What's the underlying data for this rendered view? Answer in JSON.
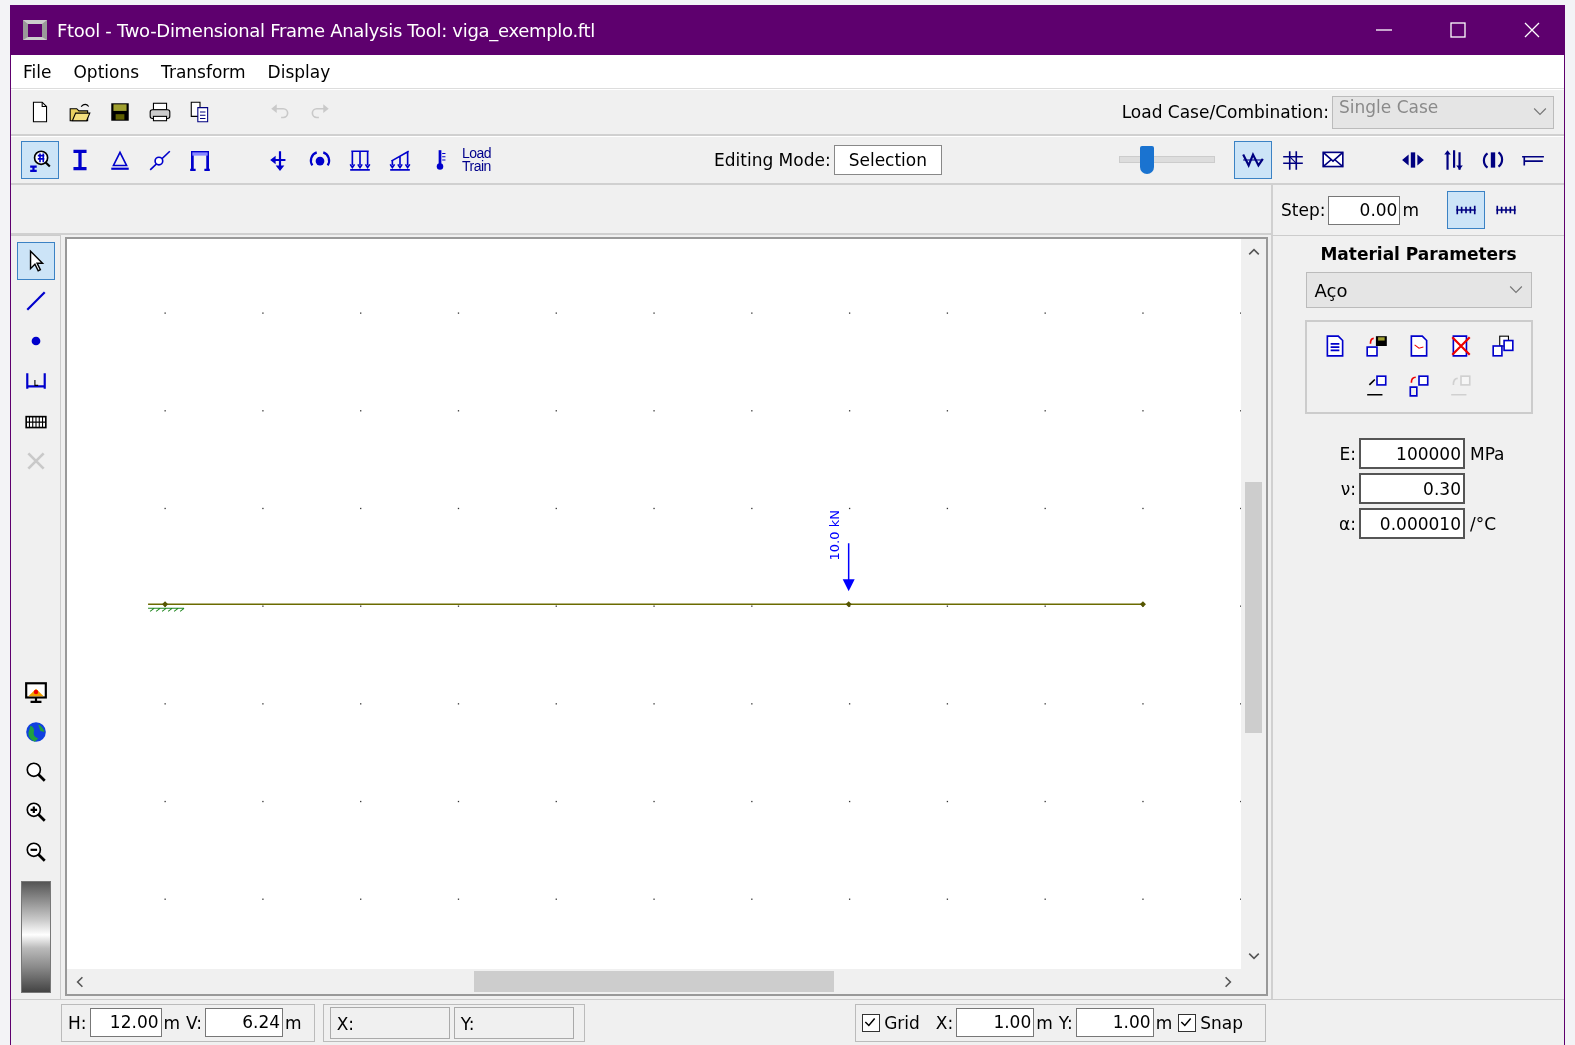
{
  "window": {
    "title": "Ftool - Two-Dimensional Frame Analysis Tool: viga_exemplo.ftl"
  },
  "menu": [
    "File",
    "Options",
    "Transform",
    "Display"
  ],
  "file_toolbar": [
    {
      "kind": "new",
      "disabled": false
    },
    {
      "kind": "open",
      "disabled": false
    },
    {
      "kind": "save",
      "disabled": false
    },
    {
      "kind": "print",
      "disabled": false
    },
    {
      "kind": "copy",
      "disabled": false
    },
    {
      "kind": "gap"
    },
    {
      "kind": "undo",
      "disabled": true
    },
    {
      "kind": "redo",
      "disabled": true
    }
  ],
  "load_case": {
    "label": "Load Case/Combination:",
    "value": "Single Case",
    "disabled": true
  },
  "model_toolbar": [
    {
      "kind": "section-query",
      "selected": true
    },
    {
      "kind": "section",
      "selected": false
    },
    {
      "kind": "support",
      "selected": false
    },
    {
      "kind": "hinge",
      "selected": false
    },
    {
      "kind": "frame",
      "selected": false
    },
    {
      "kind": "gap"
    },
    {
      "kind": "nodal-load",
      "selected": false
    },
    {
      "kind": "moment-load",
      "selected": false
    },
    {
      "kind": "uniform-load",
      "selected": false
    },
    {
      "kind": "linear-load",
      "selected": false
    },
    {
      "kind": "thermal",
      "selected": false
    },
    {
      "kind": "text",
      "label": "Load Train",
      "selected": false
    }
  ],
  "editing_mode": {
    "label": "Editing Mode:",
    "value": "Selection"
  },
  "slider": {
    "level": 0.25
  },
  "view_toolbar": [
    {
      "kind": "diagram",
      "selected": true
    },
    {
      "kind": "fit",
      "selected": false
    },
    {
      "kind": "envelope",
      "selected": false
    },
    {
      "kind": "gap"
    },
    {
      "kind": "move-x",
      "selected": false
    },
    {
      "kind": "move-y",
      "selected": false
    },
    {
      "kind": "rotate",
      "selected": false
    },
    {
      "kind": "mirror",
      "selected": false
    }
  ],
  "step": {
    "label": "Step:",
    "value": "0.00",
    "unit": "m",
    "modes": [
      {
        "kind": "ruler",
        "selected": true
      },
      {
        "kind": "ruler",
        "selected": false
      }
    ]
  },
  "tools": [
    {
      "kind": "select",
      "selected": true,
      "disabled": false
    },
    {
      "kind": "line",
      "selected": false,
      "disabled": false
    },
    {
      "kind": "node",
      "selected": false,
      "disabled": false
    },
    {
      "kind": "dimension",
      "selected": false,
      "disabled": false
    },
    {
      "kind": "keyboard",
      "selected": false,
      "disabled": false
    },
    {
      "kind": "delete",
      "selected": false,
      "disabled": true
    }
  ],
  "view_tools": [
    {
      "kind": "display"
    },
    {
      "kind": "globe"
    },
    {
      "kind": "zoom"
    },
    {
      "kind": "zoom-in"
    },
    {
      "kind": "zoom-out"
    }
  ],
  "canvas": {
    "load_label": "10.0 kN"
  },
  "material": {
    "title": "Material Parameters",
    "selected_material": "Aço",
    "actions": [
      {
        "kind": "new",
        "disabled": false
      },
      {
        "kind": "save",
        "disabled": false
      },
      {
        "kind": "rename",
        "disabled": false
      },
      {
        "kind": "delete",
        "disabled": false
      },
      {
        "kind": "copy",
        "disabled": false
      },
      {
        "kind": "break"
      },
      {
        "kind": "assign",
        "disabled": false
      },
      {
        "kind": "assign-all",
        "disabled": false
      },
      {
        "kind": "unassign",
        "disabled": true
      }
    ],
    "fields": [
      {
        "label": "E:",
        "value": "100000",
        "unit": "MPa"
      },
      {
        "label": "ν:",
        "value": "0.30"
      },
      {
        "label": "α:",
        "value": "0.000010",
        "unit": "/°C"
      }
    ]
  },
  "status_bar": {
    "h": {
      "label": "H:",
      "value": "12.00",
      "unit": "m"
    },
    "v": {
      "label": "V:",
      "value": "6.24",
      "unit": "m"
    },
    "x_label": "X:",
    "y_label": "Y:",
    "grid": {
      "label": "Grid",
      "checked": true
    },
    "grid_x": {
      "label": "X:",
      "value": "1.00",
      "unit": "m"
    },
    "grid_y": {
      "label": "Y:",
      "value": "1.00",
      "unit": "m"
    },
    "snap": {
      "label": "Snap",
      "checked": true
    }
  }
}
